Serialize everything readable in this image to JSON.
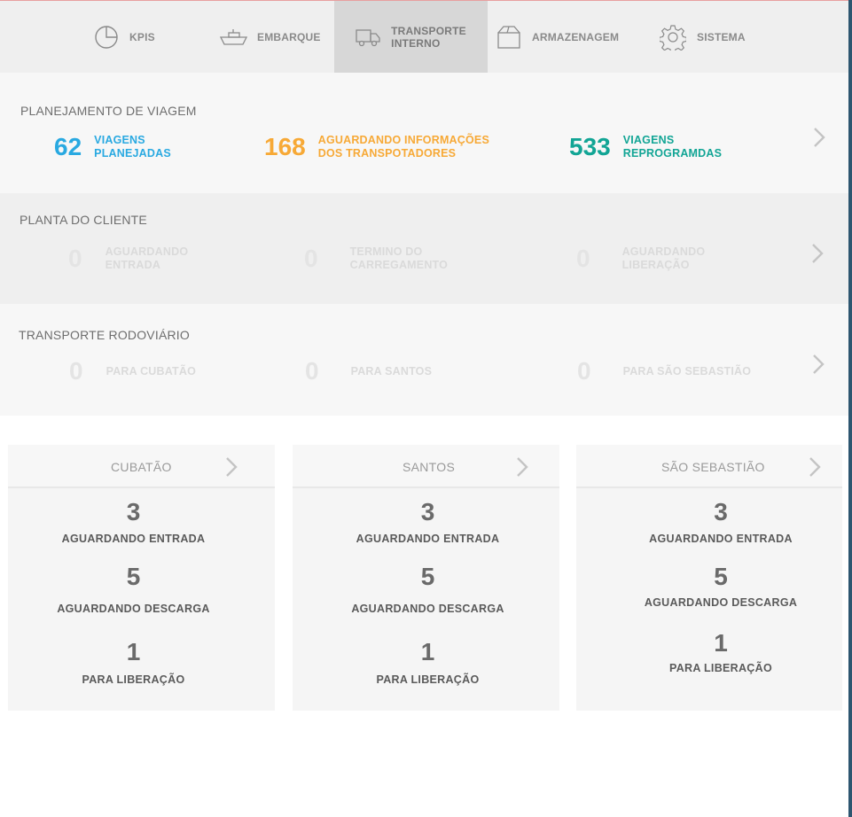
{
  "nav": {
    "items": [
      {
        "label": "KPIS",
        "icon": "pie-chart-icon"
      },
      {
        "label": "EMBARQUE",
        "icon": "ship-icon"
      },
      {
        "label": "TRANSPORTE\nINTERNO",
        "icon": "truck-icon"
      },
      {
        "label": "ARMAZENAGEM",
        "icon": "box-icon"
      },
      {
        "label": "SISTEMA",
        "icon": "gear-icon"
      }
    ],
    "active": "TRANSPORTE INTERNO"
  },
  "planejamento": {
    "title": "PLANEJAMENTO DE VIAGEM",
    "metrics": [
      {
        "value": "62",
        "label": "VIAGENS\nPLANEJADAS",
        "color": "#29a9e1"
      },
      {
        "value": "168",
        "label": "AGUARDANDO INFORMAÇÕES\nDOS TRANSPOTADORES",
        "color": "#f7a936"
      },
      {
        "value": "533",
        "label": "VIAGENS\nREPROGRAMDAS",
        "color": "#12a595"
      }
    ]
  },
  "planta": {
    "title": "PLANTA DO CLIENTE",
    "metrics": [
      {
        "value": "0",
        "label": "AGUARDANDO\nENTRADA"
      },
      {
        "value": "0",
        "label": "TERMINO DO\nCARREGAMENTO"
      },
      {
        "value": "0",
        "label": "AGUARDANDO\nLIBERAÇÃO"
      }
    ]
  },
  "rodoviario": {
    "title": "TRANSPORTE RODOVIÁRIO",
    "metrics": [
      {
        "value": "0",
        "label": "PARA CUBATÃO"
      },
      {
        "value": "0",
        "label": "PARA SANTOS"
      },
      {
        "value": "0",
        "label": "PARA SÃO SEBASTIÃO"
      }
    ]
  },
  "cards": [
    {
      "title": "CUBATÃO",
      "stats": [
        {
          "value": "3",
          "label": "AGUARDANDO ENTRADA"
        },
        {
          "value": "5",
          "label": "AGUARDANDO DESCARGA"
        },
        {
          "value": "1",
          "label": "PARA LIBERAÇÃO"
        }
      ]
    },
    {
      "title": "SANTOS",
      "stats": [
        {
          "value": "3",
          "label": "AGUARDANDO ENTRADA"
        },
        {
          "value": "5",
          "label": "AGUARDANDO DESCARGA"
        },
        {
          "value": "1",
          "label": "PARA LIBERAÇÃO"
        }
      ]
    },
    {
      "title": "SÃO SEBASTIÃO",
      "stats": [
        {
          "value": "3",
          "label": "AGUARDANDO ENTRADA"
        },
        {
          "value": "5",
          "label": "AGUARDANDO DESCARGA"
        },
        {
          "value": "1",
          "label": "PARA LIBERAÇÃO"
        }
      ]
    }
  ],
  "colors": {
    "muted_number": "#e4e4e4",
    "muted_label": "#dadada",
    "chevron": "#c4c4c4"
  }
}
